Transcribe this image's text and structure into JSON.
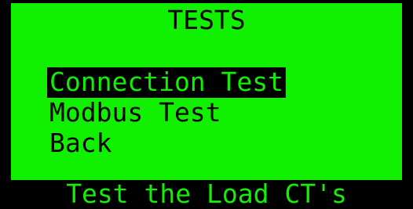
{
  "screen": {
    "title": "TESTS",
    "colors": {
      "background": "#10f000",
      "foreground": "#000000",
      "frame": "#000000"
    }
  },
  "menu": {
    "items": [
      {
        "label": "Connection Test",
        "selected": true
      },
      {
        "label": "Modbus Test",
        "selected": false
      },
      {
        "label": "Back",
        "selected": false
      }
    ]
  },
  "status_bar": {
    "text": "Test the Load CT's"
  }
}
